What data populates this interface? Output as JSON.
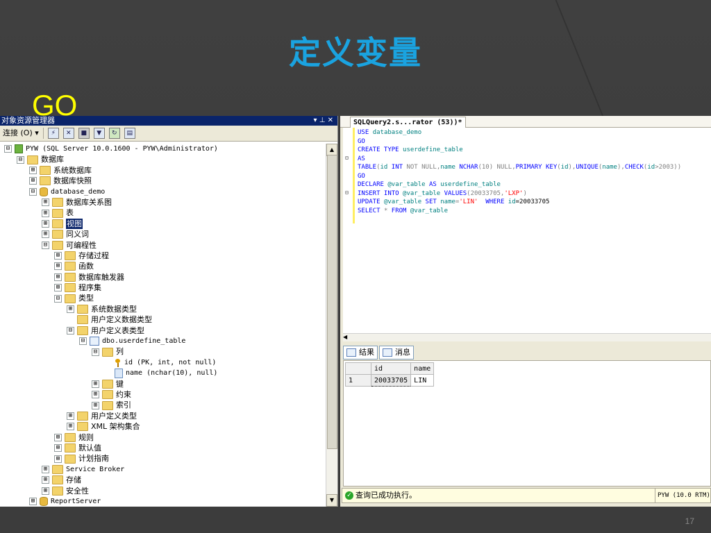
{
  "slide": {
    "title": "定义变量",
    "overlay_text": "GO",
    "page_number": "17",
    "colors": {
      "title": "#1aa3e0",
      "overlay": "#ffff00",
      "background": "#3b3b3b"
    }
  },
  "object_explorer": {
    "title": "对象资源管理器",
    "title_controls": "▾ ⊥ ✕",
    "toolbar": {
      "connect_label": "连接 (O) ▾",
      "icons": [
        "connect-icon",
        "disconnect-icon",
        "stop-icon",
        "filter-icon",
        "refresh-icon",
        "summary-icon"
      ]
    },
    "tree": [
      {
        "level": 0,
        "exp": "⊟",
        "icon": "server",
        "label": "PYW (SQL Server 10.0.1600 - PYW\\Administrator)",
        "mono": true
      },
      {
        "level": 1,
        "exp": "⊟",
        "icon": "folder",
        "label": "数据库"
      },
      {
        "level": 2,
        "exp": "⊞",
        "icon": "folder",
        "label": "系统数据库"
      },
      {
        "level": 2,
        "exp": "⊞",
        "icon": "folder",
        "label": "数据库快照"
      },
      {
        "level": 2,
        "exp": "⊟",
        "icon": "db",
        "label": "database_demo",
        "mono": true
      },
      {
        "level": 3,
        "exp": "⊞",
        "icon": "folder",
        "label": "数据库关系图"
      },
      {
        "level": 3,
        "exp": "⊞",
        "icon": "folder",
        "label": "表"
      },
      {
        "level": 3,
        "exp": "⊞",
        "icon": "folder",
        "label": "视图",
        "selected": true
      },
      {
        "level": 3,
        "exp": "⊞",
        "icon": "folder",
        "label": "同义词"
      },
      {
        "level": 3,
        "exp": "⊟",
        "icon": "folder",
        "label": "可编程性"
      },
      {
        "level": 4,
        "exp": "⊞",
        "icon": "folder",
        "label": "存储过程"
      },
      {
        "level": 4,
        "exp": "⊞",
        "icon": "folder",
        "label": "函数"
      },
      {
        "level": 4,
        "exp": "⊞",
        "icon": "folder",
        "label": "数据库触发器"
      },
      {
        "level": 4,
        "exp": "⊞",
        "icon": "folder",
        "label": "程序集"
      },
      {
        "level": 4,
        "exp": "⊟",
        "icon": "folder",
        "label": "类型"
      },
      {
        "level": 5,
        "exp": "⊞",
        "icon": "folder",
        "label": "系统数据类型"
      },
      {
        "level": 5,
        "exp": "",
        "icon": "folder",
        "label": "用户定义数据类型"
      },
      {
        "level": 5,
        "exp": "⊟",
        "icon": "folder",
        "label": "用户定义表类型"
      },
      {
        "level": 6,
        "exp": "⊟",
        "icon": "table",
        "label": "dbo.userdefine_table",
        "mono": true
      },
      {
        "level": 7,
        "exp": "⊟",
        "icon": "folder",
        "label": "列"
      },
      {
        "level": 8,
        "exp": "",
        "icon": "key",
        "label": "id (PK, int, not null)",
        "mono": true
      },
      {
        "level": 8,
        "exp": "",
        "icon": "col",
        "label": "name (nchar(10), null)",
        "mono": true
      },
      {
        "level": 7,
        "exp": "⊞",
        "icon": "folder",
        "label": "键"
      },
      {
        "level": 7,
        "exp": "⊞",
        "icon": "folder",
        "label": "约束"
      },
      {
        "level": 7,
        "exp": "⊞",
        "icon": "folder",
        "label": "索引"
      },
      {
        "level": 5,
        "exp": "⊞",
        "icon": "folder",
        "label": "用户定义类型"
      },
      {
        "level": 5,
        "exp": "⊞",
        "icon": "folder",
        "label": "XML 架构集合"
      },
      {
        "level": 4,
        "exp": "⊞",
        "icon": "folder",
        "label": "规则"
      },
      {
        "level": 4,
        "exp": "⊞",
        "icon": "folder",
        "label": "默认值"
      },
      {
        "level": 4,
        "exp": "⊞",
        "icon": "folder",
        "label": "计划指南"
      },
      {
        "level": 3,
        "exp": "⊞",
        "icon": "folder",
        "label": "Service Broker",
        "mono": true
      },
      {
        "level": 3,
        "exp": "⊞",
        "icon": "folder",
        "label": "存储"
      },
      {
        "level": 3,
        "exp": "⊞",
        "icon": "folder",
        "label": "安全性"
      },
      {
        "level": 2,
        "exp": "⊞",
        "icon": "db",
        "label": "ReportServer",
        "mono": true
      }
    ]
  },
  "query_editor": {
    "tab_label": "SQLQuery2.s...rator (53))*",
    "code_lines": [
      [
        {
          "t": "USE ",
          "c": "kw"
        },
        {
          "t": "database_demo",
          "c": "obj"
        }
      ],
      [
        {
          "t": "GO",
          "c": "kw"
        }
      ],
      [
        {
          "t": "CREATE TYPE ",
          "c": "kw"
        },
        {
          "t": "userdefine_table",
          "c": "obj"
        }
      ],
      [
        {
          "t": "AS",
          "c": "kw"
        }
      ],
      [
        {
          "t": "TABLE",
          "c": "kw"
        },
        {
          "t": "(",
          "c": "gray"
        },
        {
          "t": "id ",
          "c": "obj"
        },
        {
          "t": "INT ",
          "c": "kw"
        },
        {
          "t": "NOT NULL",
          "c": "gray"
        },
        {
          "t": ",",
          "c": "gray"
        },
        {
          "t": "name ",
          "c": "obj"
        },
        {
          "t": "NCHAR",
          "c": "kw"
        },
        {
          "t": "(10) ",
          "c": "gray"
        },
        {
          "t": "NULL",
          "c": "gray"
        },
        {
          "t": ",",
          "c": "gray"
        },
        {
          "t": "PRIMARY KEY",
          "c": "kw"
        },
        {
          "t": "(",
          "c": "gray"
        },
        {
          "t": "id",
          "c": "obj"
        },
        {
          "t": "),",
          "c": "gray"
        },
        {
          "t": "UNIQUE",
          "c": "kw"
        },
        {
          "t": "(",
          "c": "gray"
        },
        {
          "t": "name",
          "c": "obj"
        },
        {
          "t": "),",
          "c": "gray"
        },
        {
          "t": "CHECK",
          "c": "kw"
        },
        {
          "t": "(",
          "c": "gray"
        },
        {
          "t": "id",
          "c": "obj"
        },
        {
          "t": ">2003))",
          "c": "gray"
        }
      ],
      [
        {
          "t": "GO",
          "c": "kw"
        }
      ],
      [
        {
          "t": "DECLARE ",
          "c": "kw"
        },
        {
          "t": "@var_table ",
          "c": "obj"
        },
        {
          "t": "AS ",
          "c": "kw"
        },
        {
          "t": "userdefine_table",
          "c": "obj"
        }
      ],
      [
        {
          "t": "INSERT INTO ",
          "c": "kw"
        },
        {
          "t": "@var_table ",
          "c": "obj"
        },
        {
          "t": "VALUES",
          "c": "kw"
        },
        {
          "t": "(20033705,",
          "c": "gray"
        },
        {
          "t": "'LXP'",
          "c": "str"
        },
        {
          "t": ")",
          "c": "gray"
        }
      ],
      [
        {
          "t": "UPDATE ",
          "c": "kw"
        },
        {
          "t": "@var_table ",
          "c": "obj"
        },
        {
          "t": "SET ",
          "c": "kw"
        },
        {
          "t": "name",
          "c": "obj"
        },
        {
          "t": "=",
          "c": "gray"
        },
        {
          "t": "'LIN'",
          "c": "str"
        },
        {
          "t": "  WHERE ",
          "c": "kw"
        },
        {
          "t": "id",
          "c": "obj"
        },
        {
          "t": "=20033705",
          "c": ""
        }
      ],
      [
        {
          "t": "SELECT ",
          "c": "kw"
        },
        {
          "t": "* ",
          "c": "gray"
        },
        {
          "t": "FROM ",
          "c": "kw"
        },
        {
          "t": "@var_table",
          "c": "obj"
        }
      ]
    ],
    "results_tab": "结果",
    "messages_tab": "消息",
    "grid": {
      "columns": [
        "id",
        "name"
      ],
      "rows": [
        {
          "row": "1",
          "id": "20033705",
          "name": "LIN"
        }
      ]
    },
    "status_message": "查询已成功执行。",
    "status_server": "PYW (10.0 RTM)"
  }
}
